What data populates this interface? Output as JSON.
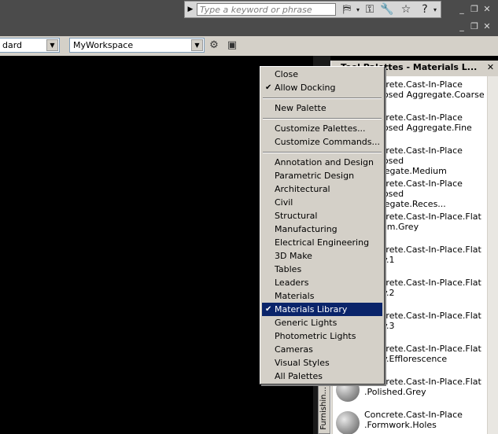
{
  "search": {
    "placeholder": "Type a keyword or phrase"
  },
  "toolbar": {
    "style_combo_value": "dard",
    "workspace_combo_value": "MyWorkspace"
  },
  "palette": {
    "title": "Tool Palettes - Materials L...",
    "tab_label": "Furnishin...",
    "items": [
      "Concrete.Cast-In-Place\n.Exposed Aggregate.Coarse",
      "Concrete.Cast-In-Place\n.Exposed Aggregate.Fine",
      "Concrete.Cast-In-Place\n.Exposed Aggregate.Medium",
      "Concrete.Cast-In-Place\n.Exposed Aggregate.Reces...",
      "Concrete.Cast-In-Place.Flat\n.Broom.Grey",
      "Concrete.Cast-In-Place.Flat\n.Grey.1",
      "Concrete.Cast-In-Place.Flat\n.Grey.2",
      "Concrete.Cast-In-Place.Flat\n.Grey.3",
      "Concrete.Cast-In-Place.Flat\n.Grey.Efflorescence",
      "Concrete.Cast-In-Place.Flat\n.Polished.Grey",
      "Concrete.Cast-In-Place\n.Formwork.Holes"
    ]
  },
  "menu": {
    "items": [
      {
        "label": "Close",
        "checked": false
      },
      {
        "label": "Allow Docking",
        "checked": true
      },
      {
        "label": "New Palette",
        "checked": false
      },
      {
        "label": "Customize Palettes...",
        "checked": false
      },
      {
        "label": "Customize Commands...",
        "checked": false
      },
      {
        "label": "Annotation and Design",
        "checked": false
      },
      {
        "label": "Parametric Design",
        "checked": false
      },
      {
        "label": "Architectural",
        "checked": false
      },
      {
        "label": "Civil",
        "checked": false
      },
      {
        "label": "Structural",
        "checked": false
      },
      {
        "label": "Manufacturing",
        "checked": false
      },
      {
        "label": "Electrical Engineering",
        "checked": false
      },
      {
        "label": "3D Make",
        "checked": false
      },
      {
        "label": "Tables",
        "checked": false
      },
      {
        "label": "Leaders",
        "checked": false
      },
      {
        "label": "Materials",
        "checked": false
      },
      {
        "label": "Materials Library",
        "checked": true,
        "selected": true
      },
      {
        "label": "Generic Lights",
        "checked": false
      },
      {
        "label": "Photometric Lights",
        "checked": false
      },
      {
        "label": "Cameras",
        "checked": false
      },
      {
        "label": "Visual Styles",
        "checked": false
      },
      {
        "label": "All Palettes",
        "checked": false
      }
    ],
    "check_glyph": "✔",
    "selected_color": "#0a246a"
  },
  "icons": {
    "binoculars": "binoculars-icon",
    "wrench": "wrench-icon",
    "star": "star-icon",
    "help": "help-icon"
  }
}
